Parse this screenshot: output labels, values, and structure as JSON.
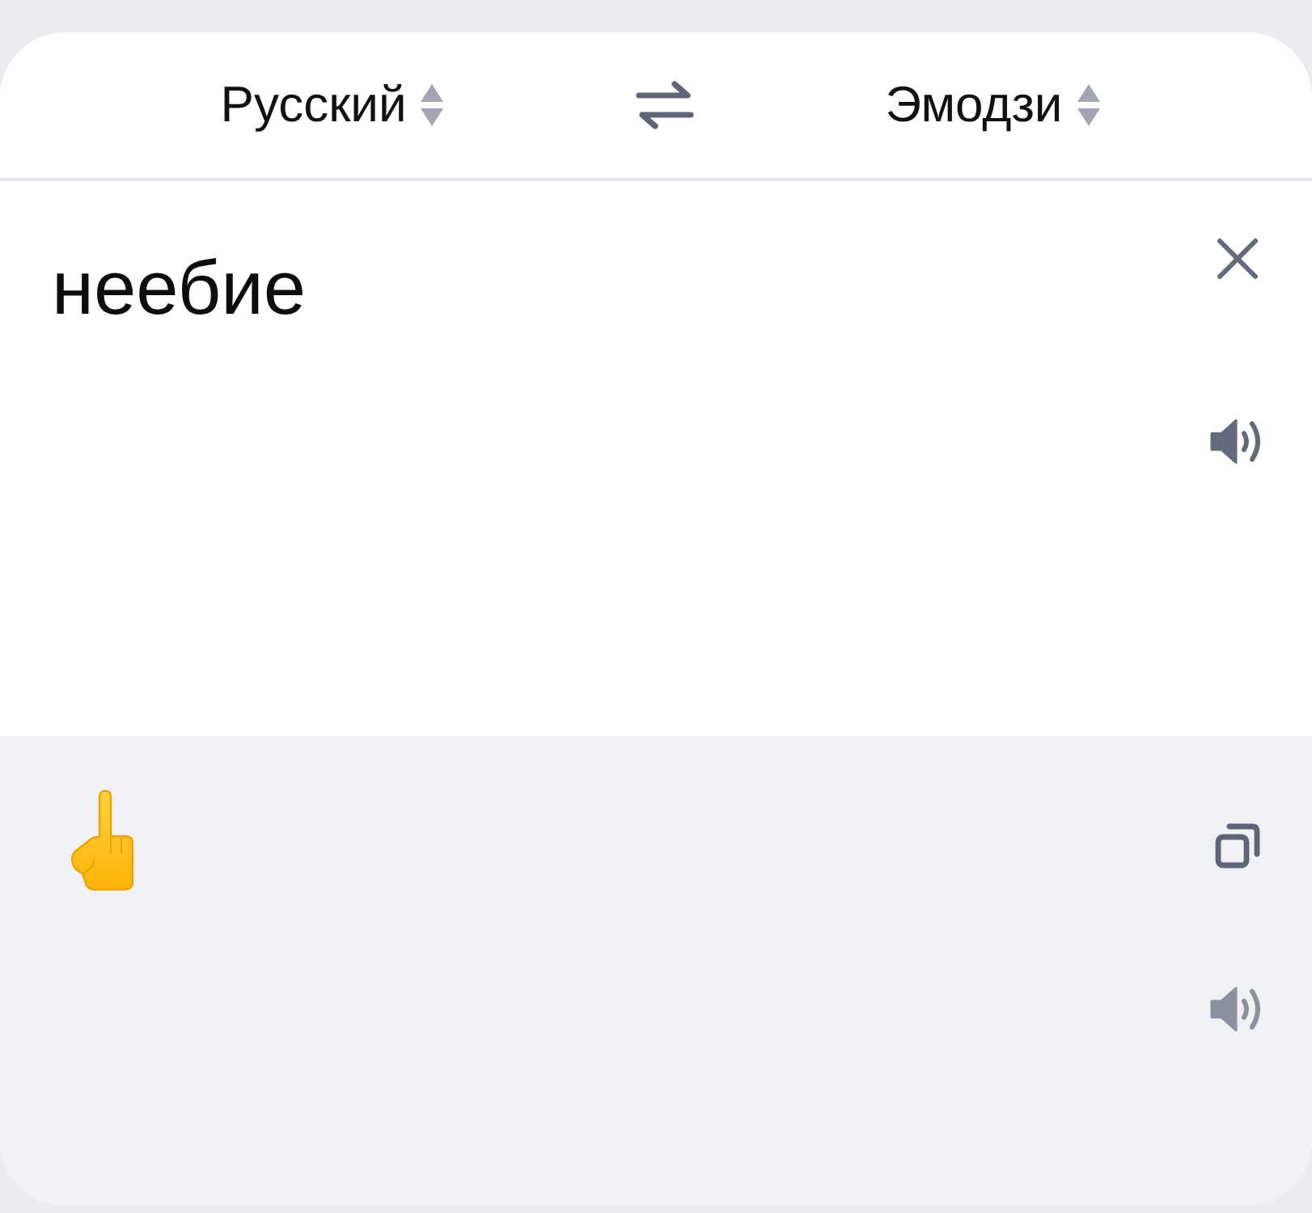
{
  "header": {
    "source_language": {
      "label": "Русский"
    },
    "target_language": {
      "label": "Эмодзи"
    }
  },
  "input": {
    "value": "неебие",
    "actions": [
      {
        "kind": "clear"
      },
      {
        "kind": "speak",
        "disabled": false
      }
    ]
  },
  "output": {
    "kind": "emoji",
    "actions": [
      {
        "kind": "copy"
      },
      {
        "kind": "speak",
        "disabled": true
      }
    ]
  }
}
